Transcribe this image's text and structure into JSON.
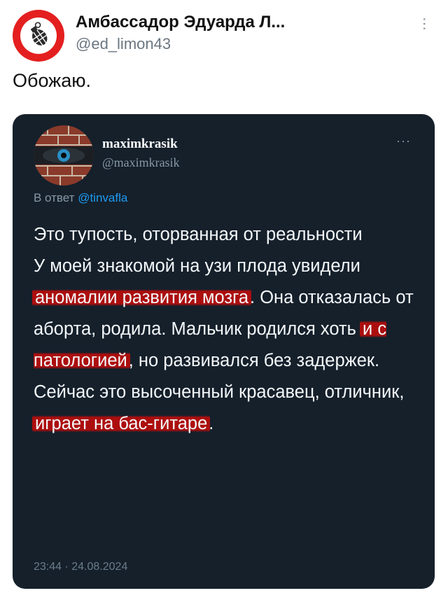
{
  "author": {
    "name": "Амбассадор Эдуарда Л...",
    "handle": "@ed_limon43",
    "avatar_icon": "grenade-icon"
  },
  "post": {
    "text": "Обожаю."
  },
  "quoted": {
    "name": "maximkrasik",
    "handle": "@maximkrasik",
    "avatar_icon": "eye-brick-avatar",
    "reply_prefix": "В ответ",
    "reply_mention": "@tinvafla",
    "body_parts": [
      {
        "text": "Это тупость, оторванная от реальности\nУ моей знакомой на узи плода увидели ",
        "highlight": false
      },
      {
        "text": "аномалии развития мозга",
        "highlight": true
      },
      {
        "text": ". Она отказалась от аборта, родила. Мальчик родился хоть ",
        "highlight": false
      },
      {
        "text": "и с патологией",
        "highlight": true
      },
      {
        "text": ", но развивался без задержек. Сейчас это высоченный красавец, отличник, ",
        "highlight": false
      },
      {
        "text": "играет на бас-гитаре",
        "highlight": true
      },
      {
        "text": ".",
        "highlight": false
      }
    ],
    "timestamp": "23:44 · 24.08.2024"
  },
  "colors": {
    "card_bg": "#15202b",
    "highlight": "#b90c0c",
    "mention": "#1d9bf0",
    "avatar_ring": "#e41f1f"
  }
}
